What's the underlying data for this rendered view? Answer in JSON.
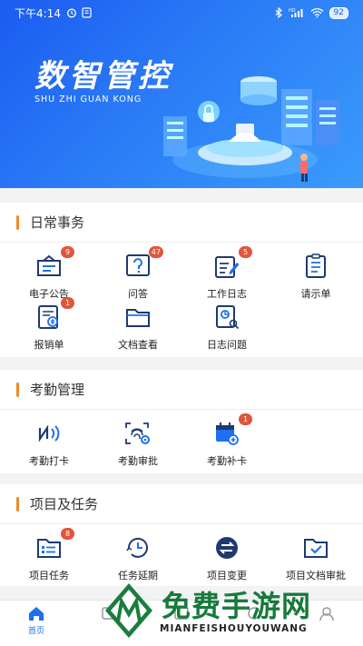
{
  "status_bar": {
    "time": "下午4:14",
    "network": "HD",
    "battery": "92"
  },
  "banner": {
    "title": "数智管控",
    "subtitle": "SHU  ZHI  GUAN  KONG"
  },
  "sections": [
    {
      "title": "日常事务",
      "items": [
        {
          "label": "电子公告",
          "icon": "announcement-icon",
          "badge": "9"
        },
        {
          "label": "问答",
          "icon": "question-icon",
          "badge": "47"
        },
        {
          "label": "工作日志",
          "icon": "work-log-icon",
          "badge": "5"
        },
        {
          "label": "请示单",
          "icon": "request-form-icon",
          "badge": ""
        },
        {
          "label": "报销单",
          "icon": "reimbursement-icon",
          "badge": "1"
        },
        {
          "label": "文档查看",
          "icon": "folder-icon",
          "badge": ""
        },
        {
          "label": "日志问题",
          "icon": "log-issue-icon",
          "badge": ""
        }
      ]
    },
    {
      "title": "考勤管理",
      "items": [
        {
          "label": "考勤打卡",
          "icon": "nfc-icon",
          "badge": ""
        },
        {
          "label": "考勤审批",
          "icon": "fingerprint-settings-icon",
          "badge": ""
        },
        {
          "label": "考勤补卡",
          "icon": "calendar-add-icon",
          "badge": "1"
        }
      ]
    },
    {
      "title": "项目及任务",
      "items": [
        {
          "label": "项目任务",
          "icon": "task-list-icon",
          "badge": "8"
        },
        {
          "label": "任务延期",
          "icon": "clock-history-icon",
          "badge": ""
        },
        {
          "label": "项目变更",
          "icon": "swap-icon",
          "badge": ""
        },
        {
          "label": "项目文档审批",
          "icon": "folder-check-icon",
          "badge": ""
        }
      ]
    }
  ],
  "tabbar": [
    {
      "label": "首页",
      "icon": "home-icon",
      "active": true
    },
    {
      "label": "",
      "icon": "tab-2-icon",
      "active": false
    },
    {
      "label": "",
      "icon": "tab-3-icon",
      "active": false
    },
    {
      "label": "",
      "icon": "tab-4-icon",
      "active": false
    },
    {
      "label": "",
      "icon": "tab-5-icon",
      "active": false
    }
  ],
  "watermark": {
    "cn": "免费手游网",
    "en": "MIANFEISHOUYOUWANG"
  },
  "colors": {
    "primary": "#1e6ff1",
    "accent": "#f08a24",
    "badge": "#e0563a"
  }
}
